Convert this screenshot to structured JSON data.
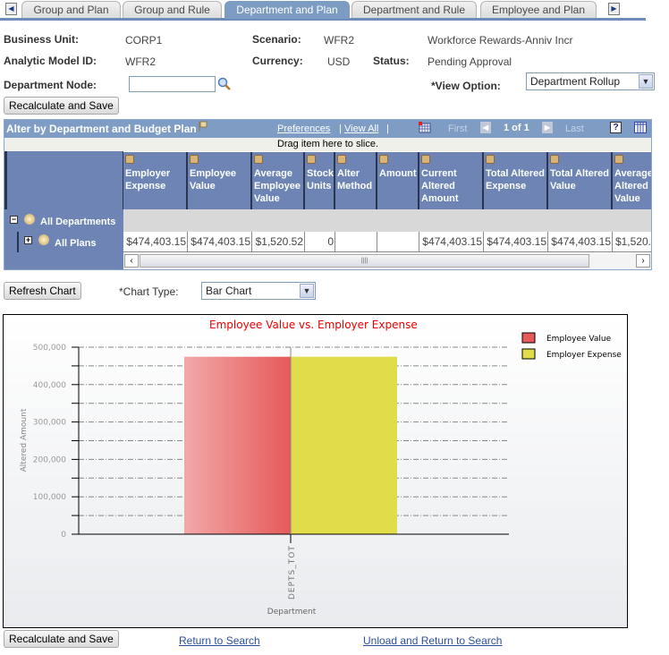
{
  "tabs": [
    {
      "label": "Group and Plan",
      "active": false
    },
    {
      "label": "Group and Rule",
      "active": false
    },
    {
      "label": "Department and Plan",
      "active": true
    },
    {
      "label": "Department and Rule",
      "active": false
    },
    {
      "label": "Employee and Plan",
      "active": false
    }
  ],
  "header": {
    "business_unit_label": "Business Unit:",
    "business_unit": "CORP1",
    "scenario_label": "Scenario:",
    "scenario": "WFR2",
    "scenario_desc": "Workforce Rewards-Anniv Incr",
    "model_label": "Analytic Model ID:",
    "model": "WFR2",
    "currency_label": "Currency:",
    "currency": "USD",
    "status_label": "Status:",
    "status": "Pending Approval",
    "dept_node_label": "Department Node:",
    "dept_node_value": "",
    "view_option_label": "*View Option:",
    "view_option": "Department Rollup",
    "recalc_label": "Recalculate and Save"
  },
  "grid": {
    "title": "Alter by Department and Budget Plan",
    "preferences": "Preferences",
    "view_all": "View All",
    "first": "First",
    "page": "1 of 1",
    "last": "Last",
    "drag_hint": "Drag item here to slice.",
    "columns": [
      "Employer Expense",
      "Employee Value",
      "Average Employee Value",
      "Stock Units",
      "Alter Method",
      "Amount",
      "Current Altered Amount",
      "Total Altered Expense",
      "Total Altered Value",
      "Average Altered Value"
    ],
    "rows": [
      {
        "label": "All Departments",
        "values": []
      },
      {
        "label": "All Plans",
        "values": [
          "$474,403.15",
          "$474,403.15",
          "$1,520.52",
          "0",
          "",
          "",
          "$474,403.15",
          "$474,403.15",
          "$474,403.15",
          "$1,520."
        ]
      }
    ]
  },
  "chart_controls": {
    "refresh_label": "Refresh Chart",
    "chart_type_label": "*Chart Type:",
    "chart_type": "Bar Chart"
  },
  "chart_data": {
    "type": "bar",
    "title": "Employee Value vs. Employer Expense",
    "xlabel": "Department",
    "ylabel": "Altered Amount",
    "categories": [
      "DEPTS_TOT"
    ],
    "series": [
      {
        "name": "Employee Value",
        "values": [
          474403.15
        ],
        "color": "#e65a5a"
      },
      {
        "name": "Employer Expense",
        "values": [
          474403.15
        ],
        "color": "#e0dc4a"
      }
    ],
    "ylim": [
      0,
      500000
    ],
    "yticks": [
      "0",
      "100,000",
      "200,000",
      "300,000",
      "400,000",
      "500,000"
    ],
    "grid": true,
    "legend": "top-right"
  },
  "footer": {
    "recalc_label": "Recalculate and Save",
    "return_link": "Return to Search",
    "unload_link": "Unload and Return to Search"
  }
}
